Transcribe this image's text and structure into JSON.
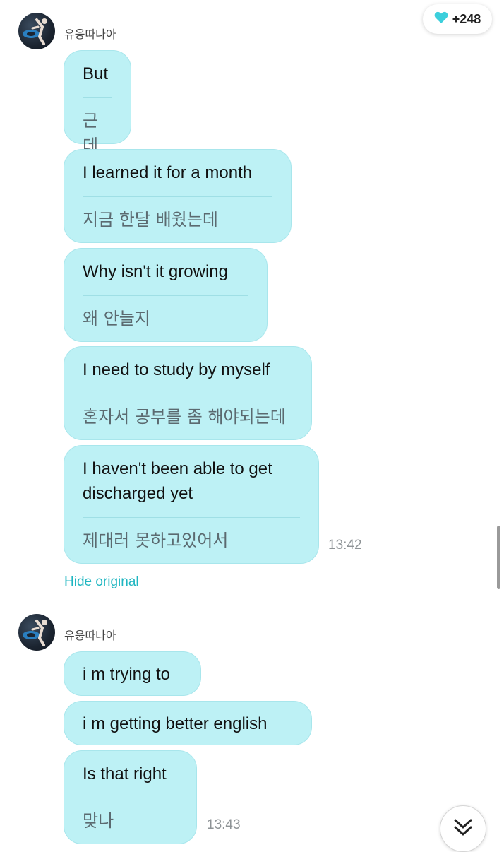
{
  "header": {
    "likes_count": "+248",
    "heart_color": "#3ccfdc"
  },
  "groups": [
    {
      "sender": "유웅따나아",
      "messages": [
        {
          "original": "But",
          "translation": "근데"
        },
        {
          "original": "I learned it for a month",
          "translation": "지금 한달 배웠는데"
        },
        {
          "original": "Why isn't it growing",
          "translation": "왜 안늘지"
        },
        {
          "original": "I need to study by myself",
          "translation": "혼자서 공부를 좀 해야되는데"
        },
        {
          "original": "I haven't been able to get discharged yet",
          "translation": "제대러 못하고있어서"
        }
      ],
      "time": "13:42",
      "hide_original_label": "Hide original"
    },
    {
      "sender": "유웅따나아",
      "messages": [
        {
          "original": "i m trying to"
        },
        {
          "original": "i m getting better english"
        },
        {
          "original": "Is that right",
          "translation": "맞나"
        }
      ],
      "time": "13:43"
    }
  ],
  "colors": {
    "bubble": "#bdf1f5",
    "accent": "#1fb6c1"
  }
}
